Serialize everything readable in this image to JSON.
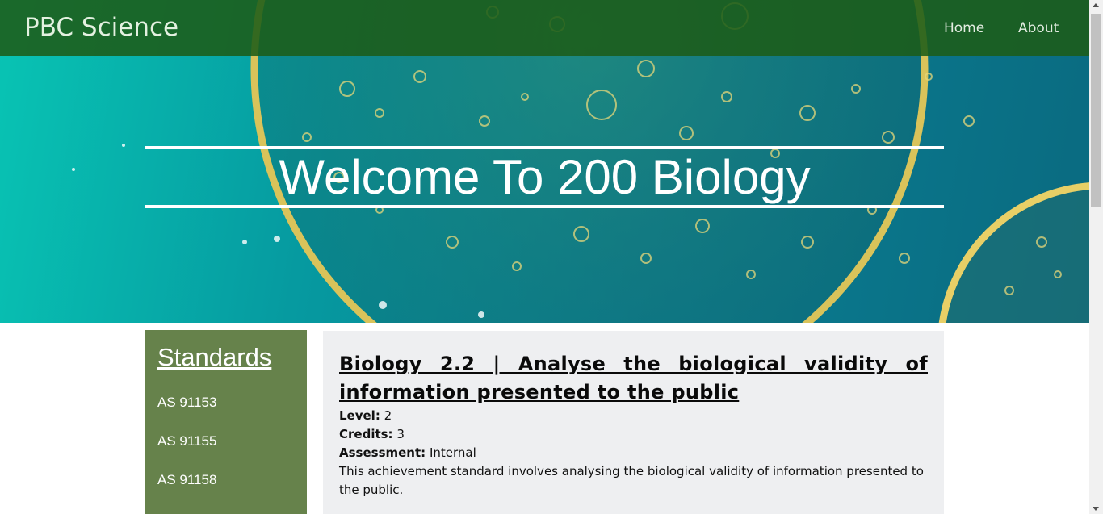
{
  "navbar": {
    "brand": "PBC Science",
    "links": [
      "Home",
      "About"
    ]
  },
  "hero": {
    "title": "Welcome To 200 Biology"
  },
  "sidebar": {
    "title": "Standards",
    "items": [
      "AS 91153",
      "AS 91155",
      "AS 91158"
    ]
  },
  "card": {
    "title": "Biology 2.2 | Analyse the biological validity of information presented to the public",
    "level_label": "Level:",
    "level_value": "2",
    "credits_label": "Credits:",
    "credits_value": "3",
    "assessment_label": "Assessment:",
    "assessment_value": "Internal",
    "description": "This achievement standard involves analysing the biological validity of information presented to the public."
  },
  "colors": {
    "navbar": "#1c5c18",
    "sidebar": "#66824b",
    "card": "#eeeff1"
  }
}
